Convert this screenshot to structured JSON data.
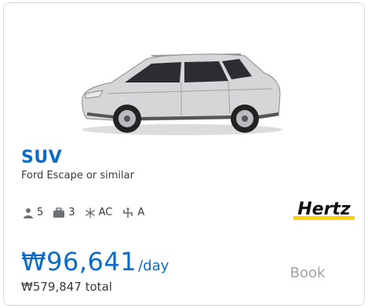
{
  "card": {
    "car_class": "SUV",
    "car_model": "Ford Escape or similar",
    "image_icon": "car-suv-image",
    "features": {
      "passengers": "5",
      "bags": "3",
      "ac": "AC",
      "transmission": "A"
    },
    "vendor": {
      "name": "Hertz",
      "colors": {
        "text": "#111111",
        "accent": "#ffd100"
      }
    },
    "price": {
      "amount": "₩96,641",
      "unit": "/day",
      "total": "₩579,847 total"
    },
    "book_label": "Book"
  },
  "colors": {
    "accent_blue": "#0b6bc7",
    "muted_text": "#a3a3a3",
    "body_text": "#3a3a3a"
  }
}
